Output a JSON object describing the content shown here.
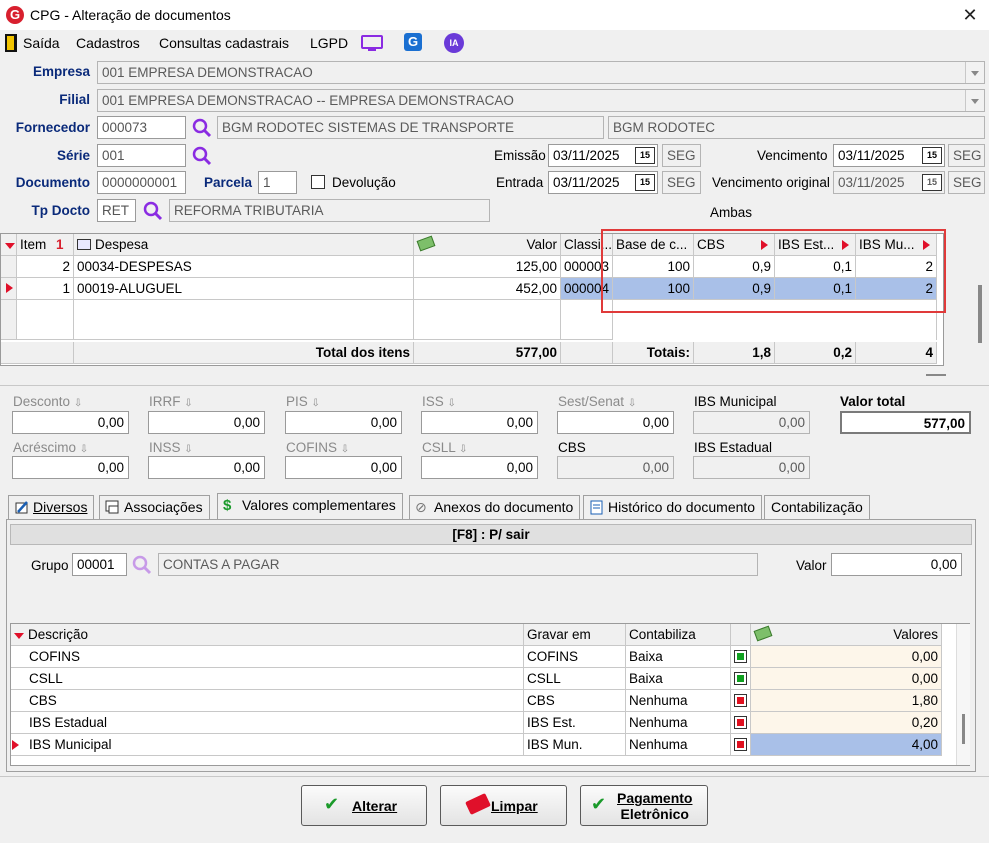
{
  "window": {
    "title": "CPG - Alteração de documentos",
    "app_logo": "G"
  },
  "menu": {
    "saida": "Saída",
    "cadastros": "Cadastros",
    "consultas": "Consultas cadastrais",
    "lgpd": "LGPD",
    "ia": "IA",
    "g_logo": "G"
  },
  "form": {
    "empresa_label": "Empresa",
    "empresa_value": "001 EMPRESA DEMONSTRACAO",
    "filial_label": "Filial",
    "filial_value": "001 EMPRESA DEMONSTRACAO -- EMPRESA DEMONSTRACAO",
    "fornecedor_label": "Fornecedor",
    "fornecedor_code": "000073",
    "fornecedor_name": "BGM RODOTEC SISTEMAS DE TRANSPORTE",
    "fornecedor_short": "BGM RODOTEC",
    "serie_label": "Série",
    "serie_value": "001",
    "documento_label": "Documento",
    "documento_value": "0000000001",
    "parcela_label": "Parcela",
    "parcela_value": "1",
    "devolucao_label": "Devolução",
    "tpdocto_label": "Tp Docto",
    "tpdocto_code": "RET",
    "tpdocto_name": "REFORMA TRIBUTARIA",
    "emissao_label": "Emissão",
    "emissao_value": "03/11/2025",
    "emissao_day": "SEG",
    "entrada_label": "Entrada",
    "entrada_value": "03/11/2025",
    "entrada_day": "SEG",
    "vencimento_label": "Vencimento",
    "vencimento_value": "03/11/2025",
    "vencimento_day": "SEG",
    "vencorig_label": "Vencimento original",
    "vencorig_value": "03/11/2025",
    "vencorig_day": "SEG",
    "ambas_label": "Ambas",
    "cal_icon_text": "15"
  },
  "items_grid": {
    "headers": {
      "item": "Item",
      "sort_icon": "1",
      "despesa": "Despesa",
      "valor": "Valor",
      "classi": "Classi...",
      "base": "Base de c...",
      "cbs": "CBS",
      "ibs_est": "IBS Est...",
      "ibs_mun": "IBS Mu..."
    },
    "rows": [
      {
        "item": "2",
        "despesa": "00034-DESPESAS",
        "valor": "125,00",
        "classi": "000003",
        "base": "100",
        "cbs": "0,9",
        "ibs_est": "0,1",
        "ibs_mun": "2"
      },
      {
        "item": "1",
        "despesa": "00019-ALUGUEL",
        "valor": "452,00",
        "classi": "000004",
        "base": "100",
        "cbs": "0,9",
        "ibs_est": "0,1",
        "ibs_mun": "2"
      }
    ],
    "totals": {
      "label": "Total dos itens",
      "valor": "577,00",
      "totais_label": "Totais:",
      "cbs": "1,8",
      "ibs_est": "0,2",
      "ibs_mun": "4"
    }
  },
  "values": {
    "desconto": {
      "label": "Desconto",
      "value": "0,00"
    },
    "irrf": {
      "label": "IRRF",
      "value": "0,00"
    },
    "pis": {
      "label": "PIS",
      "value": "0,00"
    },
    "iss": {
      "label": "ISS",
      "value": "0,00"
    },
    "sest": {
      "label": "Sest/Senat",
      "value": "0,00"
    },
    "ibs_municipal": {
      "label": "IBS Municipal",
      "value": "0,00"
    },
    "valor_total": {
      "label": "Valor total",
      "value": "577,00"
    },
    "acrescimo": {
      "label": "Acréscimo",
      "value": "0,00"
    },
    "inss": {
      "label": "INSS",
      "value": "0,00"
    },
    "cofins": {
      "label": "COFINS",
      "value": "0,00"
    },
    "csll": {
      "label": "CSLL",
      "value": "0,00"
    },
    "cbs": {
      "label": "CBS",
      "value": "0,00"
    },
    "ibs_estadual": {
      "label": "IBS Estadual",
      "value": "0,00"
    }
  },
  "tabs": [
    {
      "label": "Diversos"
    },
    {
      "label": "Associações"
    },
    {
      "label": "Valores complementares"
    },
    {
      "label": "Anexos do documento"
    },
    {
      "label": "Histórico do documento"
    },
    {
      "label": "Contabilização"
    }
  ],
  "panel": {
    "header": "[F8] : P/ sair",
    "grupo_label": "Grupo",
    "grupo_code": "00001",
    "grupo_name": "CONTAS A PAGAR",
    "valor_label": "Valor",
    "valor_value": "0,00"
  },
  "comp_grid": {
    "headers": {
      "descricao": "Descrição",
      "gravar": "Gravar em",
      "contabiliza": "Contabiliza",
      "valores": "Valores"
    },
    "rows": [
      {
        "descricao": "COFINS",
        "gravar": "COFINS",
        "contabiliza": "Baixa",
        "flag": "green",
        "valor": "0,00"
      },
      {
        "descricao": "CSLL",
        "gravar": "CSLL",
        "contabiliza": "Baixa",
        "flag": "green",
        "valor": "0,00"
      },
      {
        "descricao": "CBS",
        "gravar": "CBS",
        "contabiliza": "Nenhuma",
        "flag": "red",
        "valor": "1,80"
      },
      {
        "descricao": "IBS Estadual",
        "gravar": "IBS Est.",
        "contabiliza": "Nenhuma",
        "flag": "red",
        "valor": "0,20"
      },
      {
        "descricao": "IBS Municipal",
        "gravar": "IBS Mun.",
        "contabiliza": "Nenhuma",
        "flag": "red",
        "valor": "4,00"
      }
    ]
  },
  "buttons": {
    "alterar": "Alterar",
    "limpar": "Limpar",
    "pagamento_l1": "Pagamento",
    "pagamento_l2": "Eletrônico"
  },
  "colors": {
    "label_blue": "#0a2a7a",
    "selection": "#a9c0e8",
    "highlight": "#e03a3a",
    "accent_purple": "#8a2be2"
  }
}
